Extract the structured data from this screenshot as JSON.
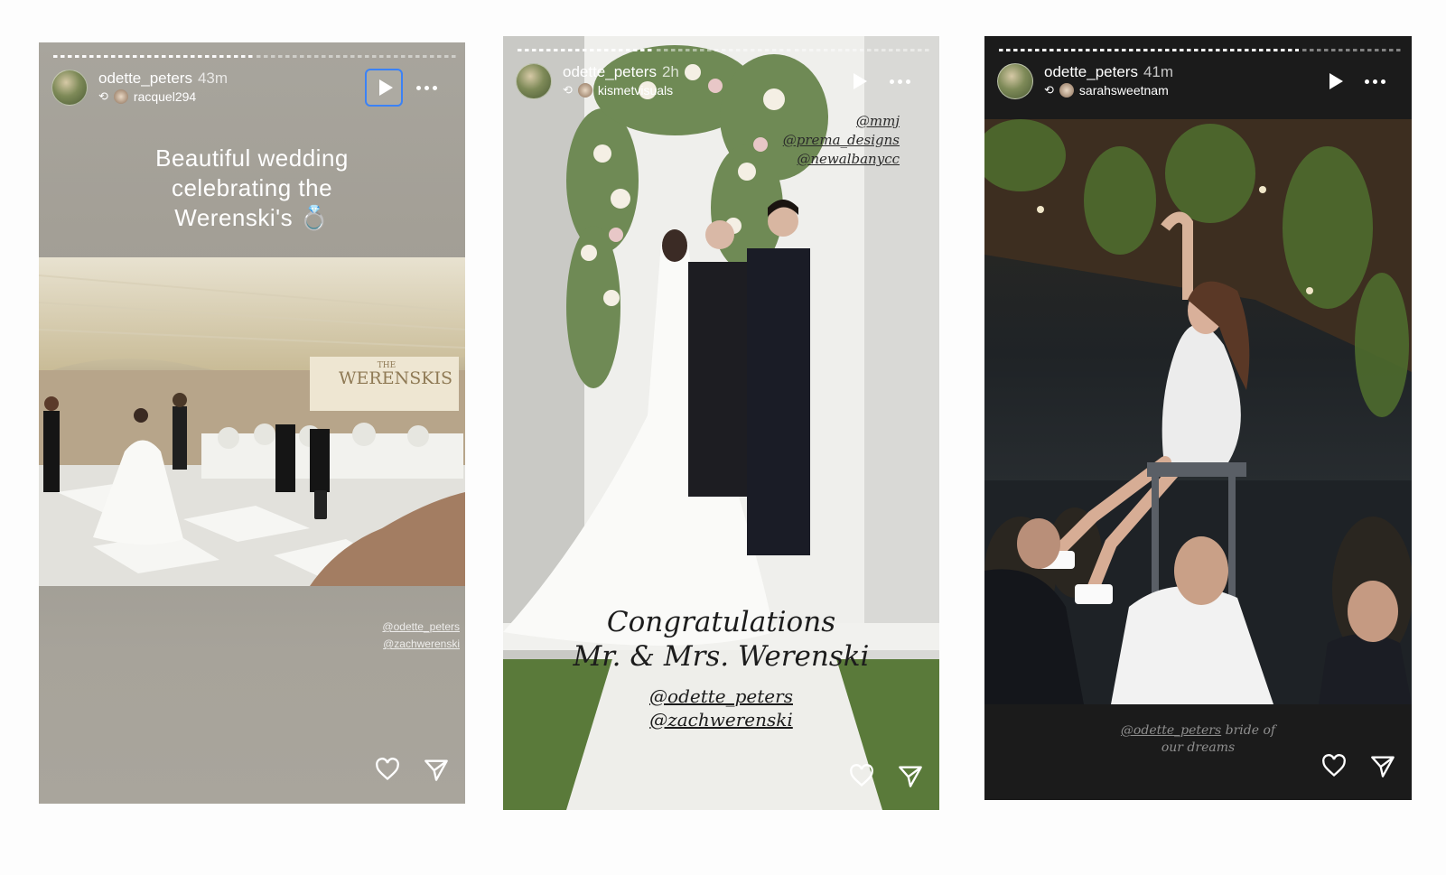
{
  "colors": {
    "page_bg": "#fdfdfd",
    "highlight": "#3b82f6",
    "story3_bg": "#1b1b1b"
  },
  "stories": [
    {
      "username": "odette_peters",
      "time": "43m",
      "repost_from": "racquel294",
      "caption_lines": [
        "Beautiful wedding",
        "celebrating the",
        "Werenski's 💍"
      ],
      "photo_sign": "THE\nWERENSKIS",
      "mentions": [
        "@odette_peters",
        "@zachwerenski"
      ],
      "play_icon": "play-icon",
      "more_icon": "more-icon",
      "like_icon": "heart-icon",
      "share_icon": "send-icon"
    },
    {
      "username": "odette_peters",
      "time": "2h",
      "repost_from": "kismetvisuals",
      "top_mentions": [
        "@mmj",
        "@prema_designs",
        "@newalbanycc"
      ],
      "caption_lines": [
        "Congratulations",
        "Mr. & Mrs. Werenski"
      ],
      "handles": [
        "@odette_peters",
        "@zachwerenski"
      ],
      "play_icon": "play-icon",
      "more_icon": "more-icon",
      "like_icon": "heart-icon",
      "share_icon": "send-icon"
    },
    {
      "username": "odette_peters",
      "time": "41m",
      "repost_from": "sarahsweetnam",
      "caption_handle": "@odette_peters",
      "caption_rest": " bride of",
      "caption_line2": "our dreams",
      "play_icon": "play-icon",
      "more_icon": "more-icon",
      "like_icon": "heart-icon",
      "share_icon": "send-icon"
    }
  ]
}
